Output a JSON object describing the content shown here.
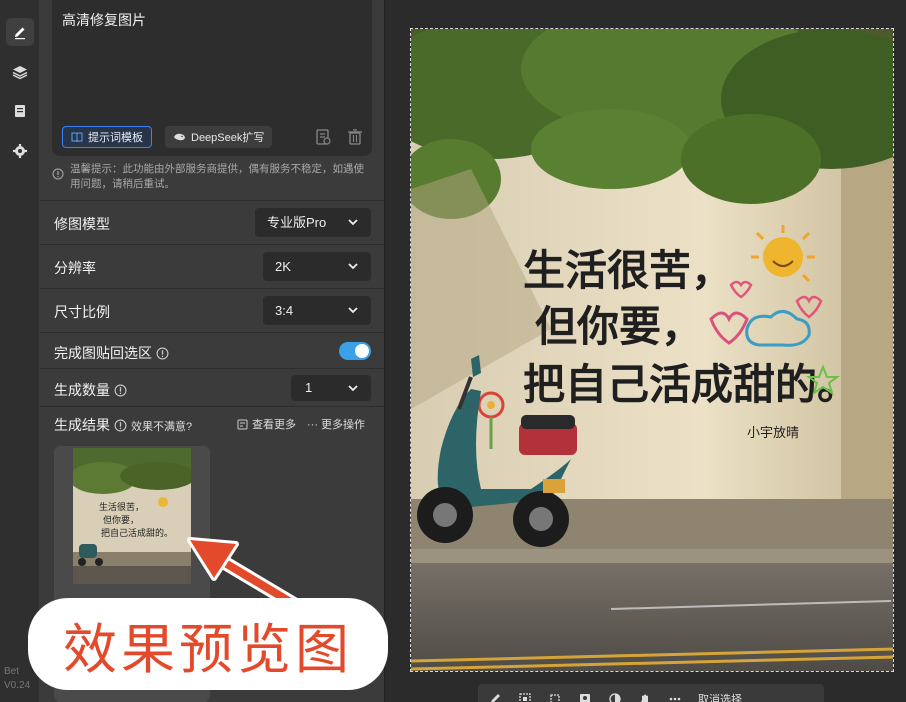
{
  "panel": {
    "prompt_text": "高清修复图片",
    "template_btn": "提示词模板",
    "deepseek_btn": "DeepSeek扩写",
    "notice": "温馨提示：此功能由外部服务商提供，偶有服务不稳定，如遇使用问题，请稍后重试。",
    "model_label": "修图模型",
    "model_value": "专业版Pro",
    "resolution_label": "分辨率",
    "resolution_value": "2K",
    "ratio_label": "尺寸比例",
    "ratio_value": "3:4",
    "paste_back_label": "完成图贴回选区",
    "paste_back_on": true,
    "count_label": "生成数量",
    "count_value": "1",
    "result_label": "生成结果",
    "result_unsatisfied": "效果不满意?",
    "view_more": "查看更多",
    "more_ops": "··· 更多操作"
  },
  "rail": {
    "version_1": "Bet",
    "version_2": "V0.24"
  },
  "canvas": {
    "wall_text_line1": "生活很苦，",
    "wall_text_line2": "但你要，",
    "wall_text_line3": "把自己活成甜的。",
    "wall_signature": "小宇放晴",
    "cancel_selection": "取消选择"
  },
  "overlay": {
    "label": "效果预览图",
    "color": "#e34a2b"
  }
}
